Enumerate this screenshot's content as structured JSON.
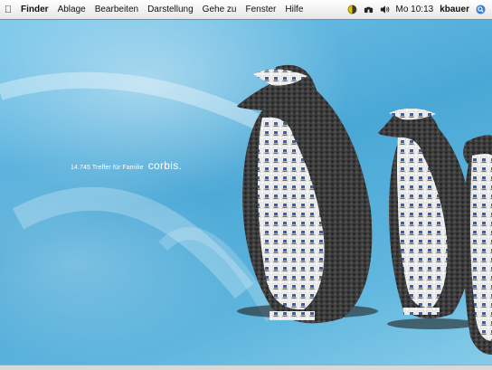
{
  "menubar": {
    "apple_icon": "apple-icon",
    "items": [
      "Finder",
      "Ablage",
      "Bearbeiten",
      "Darstellung",
      "Gehe zu",
      "Fenster",
      "Hilfe"
    ],
    "clock": "Mo 10:13",
    "user": "kbauer",
    "tray_icons": [
      "status-icon",
      "binoculars-icon",
      "volume-icon",
      "spotlight-icon"
    ]
  },
  "desktop": {
    "tagline": "14.745 Treffer für Familie",
    "brand": "corbis."
  }
}
